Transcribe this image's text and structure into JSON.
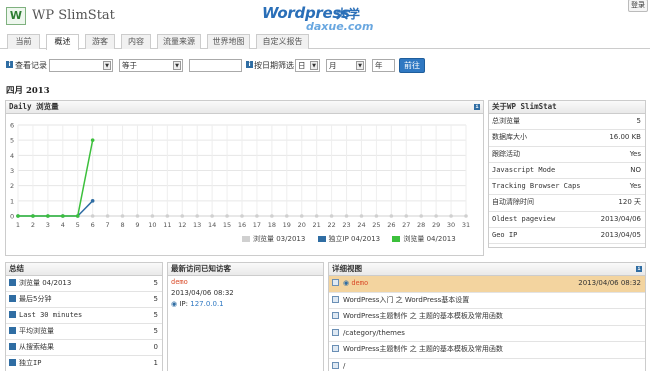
{
  "app": {
    "logo_letter": "W",
    "title": "WP SlimStat",
    "brand_line1": "Wordpress",
    "brand_line1_cn": "大学",
    "brand_line2": "daxue.com",
    "top_button": "登录"
  },
  "tabs": [
    "当前",
    "概述",
    "游客",
    "内容",
    "流量来源",
    "世界地图",
    "自定义报告"
  ],
  "active_tab": 1,
  "filter": {
    "label_view": "查看记录",
    "field_select": "",
    "operator_select": "等于",
    "value_input": "",
    "label_date": "按日期筛选",
    "day": "日",
    "month": "月",
    "year_placeholder": "年",
    "submit": "前往"
  },
  "period": "四月 2013",
  "chart_panel": {
    "title": "Daily 浏览量",
    "chart_data": {
      "type": "line",
      "x": [
        1,
        2,
        3,
        4,
        5,
        6,
        7,
        8,
        9,
        10,
        11,
        12,
        13,
        14,
        15,
        16,
        17,
        18,
        19,
        20,
        21,
        22,
        23,
        24,
        25,
        26,
        27,
        28,
        29,
        30,
        31
      ],
      "ylim": [
        0,
        6
      ],
      "yticks": [
        0,
        1,
        2,
        3,
        4,
        5,
        6
      ],
      "grid": true,
      "legend_position": "bottom-right",
      "series": [
        {
          "name": "浏览量 03/2013",
          "color": "#d0d0d0",
          "values": [
            0,
            0,
            0,
            0,
            0,
            0,
            0,
            0,
            0,
            0,
            0,
            0,
            0,
            0,
            0,
            0,
            0,
            0,
            0,
            0,
            0,
            0,
            0,
            0,
            0,
            0,
            0,
            0,
            0,
            0,
            0
          ]
        },
        {
          "name": "独立IP 04/2013",
          "color": "#2f6da3",
          "values": [
            0,
            0,
            0,
            0,
            0,
            1
          ]
        },
        {
          "name": "浏览量 04/2013",
          "color": "#3cc03c",
          "values": [
            0,
            0,
            0,
            0,
            0,
            5
          ]
        }
      ]
    }
  },
  "about": {
    "title": "关于WP SlimStat",
    "rows": [
      {
        "k": "总浏览量",
        "v": "5"
      },
      {
        "k": "数据库大小",
        "v": "16.00 KB"
      },
      {
        "k": "跟踪活动",
        "v": "Yes"
      },
      {
        "k": "Javascript Mode",
        "v": "NO"
      },
      {
        "k": "Tracking Browser Caps",
        "v": "Yes"
      },
      {
        "k": "自动清除时间",
        "v": "120 天"
      },
      {
        "k": "Oldest pageview",
        "v": "2013/04/06"
      },
      {
        "k": "Geo IP",
        "v": "2013/04/05"
      }
    ]
  },
  "summary": {
    "title": "总结",
    "rows": [
      {
        "k": "浏览量 04/2013",
        "v": "5"
      },
      {
        "k": "最后5分钟",
        "v": "5"
      },
      {
        "k": "Last 30 minutes",
        "v": "5"
      },
      {
        "k": "平均浏览量",
        "v": "5"
      },
      {
        "k": "从搜索结果",
        "v": "0"
      },
      {
        "k": "独立IP",
        "v": "1"
      }
    ]
  },
  "recent": {
    "title": "最新访问已知访客",
    "user": "demo",
    "datetime": "2013/04/06 08:32",
    "ip_label": "IP:",
    "ip": "127.0.0.1"
  },
  "detail": {
    "title": "详细视图",
    "rows": [
      {
        "text": "demo",
        "v": "2013/04/06 08:32",
        "highlight": true
      },
      {
        "text": "WordPress入门 之 WordPress基本设置",
        "v": ""
      },
      {
        "text": "WordPress主题制作 之 主题的基本模板及常用函数",
        "v": ""
      },
      {
        "text": "/category/themes",
        "v": ""
      },
      {
        "text": "WordPress主题制作 之 主题的基本模板及常用函数",
        "v": ""
      },
      {
        "text": "/",
        "v": ""
      }
    ]
  }
}
